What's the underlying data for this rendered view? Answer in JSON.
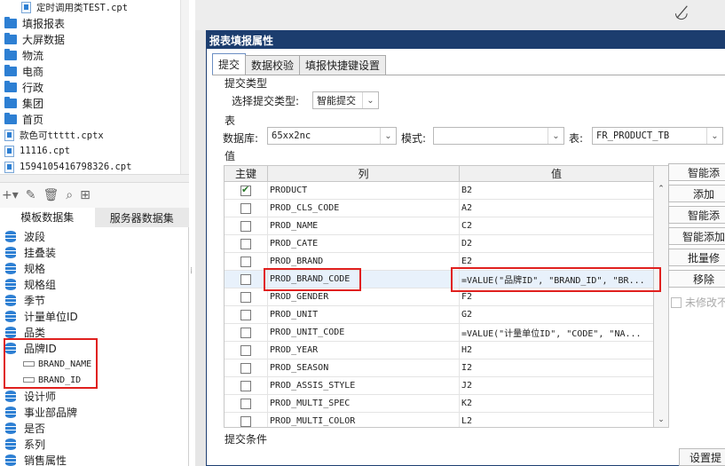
{
  "left_tree": {
    "items": [
      {
        "type": "file",
        "label": "定时调用类TEST.cpt"
      },
      {
        "type": "folder",
        "label": "填报报表"
      },
      {
        "type": "folder",
        "label": "大屏数据"
      },
      {
        "type": "folder",
        "label": "物流"
      },
      {
        "type": "folder",
        "label": "电商"
      },
      {
        "type": "folder",
        "label": "行政"
      },
      {
        "type": "folder",
        "label": "集团"
      },
      {
        "type": "folder",
        "label": "首页"
      },
      {
        "type": "file",
        "label": "款色可ttttt.cptx"
      },
      {
        "type": "file",
        "label": "11116.cpt"
      },
      {
        "type": "file",
        "label": "1594105416798326.cpt"
      }
    ]
  },
  "dataset_panel": {
    "tabs": [
      "模板数据集",
      "服务器数据集"
    ],
    "active_tab": 0,
    "datasets": [
      {
        "label": "波段"
      },
      {
        "label": "挂叠装"
      },
      {
        "label": "规格"
      },
      {
        "label": "规格组"
      },
      {
        "label": "季节"
      },
      {
        "label": "计量单位ID"
      },
      {
        "label": "品类"
      },
      {
        "label": "品牌ID"
      },
      {
        "label": "设计师"
      },
      {
        "label": "事业部品牌"
      },
      {
        "label": "是否"
      },
      {
        "label": "系列"
      },
      {
        "label": "销售属性"
      }
    ],
    "fields": [
      "BRAND_NAME",
      "BRAND_ID"
    ]
  },
  "dialog": {
    "title": "报表填报属性",
    "tabs": [
      "提交",
      "数据校验",
      "填报快捷键设置"
    ],
    "active_tab": 0,
    "submit_type_group": "提交类型",
    "select_submit_label": "选择提交类型:",
    "submit_type_value": "智能提交",
    "table_group": "表",
    "database_label": "数据库:",
    "database_value": "65xx2nc",
    "mode_label": "模式:",
    "mode_value": "",
    "table_label": "表:",
    "table_value": "FR_PRODUCT_TB",
    "value_group": "值",
    "columns": [
      "主键",
      "列",
      "值"
    ],
    "rows": [
      {
        "key": true,
        "col": "PRODUCT",
        "val": "B2"
      },
      {
        "key": false,
        "col": "PROD_CLS_CODE",
        "val": "A2"
      },
      {
        "key": false,
        "col": "PROD_NAME",
        "val": "C2"
      },
      {
        "key": false,
        "col": "PROD_CATE",
        "val": "D2"
      },
      {
        "key": false,
        "col": "PROD_BRAND",
        "val": "E2"
      },
      {
        "key": false,
        "col": "PROD_BRAND_CODE",
        "val": "=VALUE(\"品牌ID\", \"BRAND_ID\", \"BR..."
      },
      {
        "key": false,
        "col": "PROD_GENDER",
        "val": "F2"
      },
      {
        "key": false,
        "col": "PROD_UNIT",
        "val": "G2"
      },
      {
        "key": false,
        "col": "PROD_UNIT_CODE",
        "val": "=VALUE(\"计量单位ID\", \"CODE\", \"NA..."
      },
      {
        "key": false,
        "col": "PROD_YEAR",
        "val": "H2"
      },
      {
        "key": false,
        "col": "PROD_SEASON",
        "val": "I2"
      },
      {
        "key": false,
        "col": "PROD_ASSIS_STYLE",
        "val": "J2"
      },
      {
        "key": false,
        "col": "PROD_MULTI_SPEC",
        "val": "K2"
      },
      {
        "key": false,
        "col": "PROD_MULTI_COLOR",
        "val": "L2"
      }
    ],
    "right_buttons": [
      "智能添",
      "添加",
      "智能添",
      "智能添加",
      "批量修",
      "移除"
    ],
    "unmodified_label": "未修改不",
    "submit_condition_label": "提交条件",
    "bottom_button": "设置提"
  }
}
